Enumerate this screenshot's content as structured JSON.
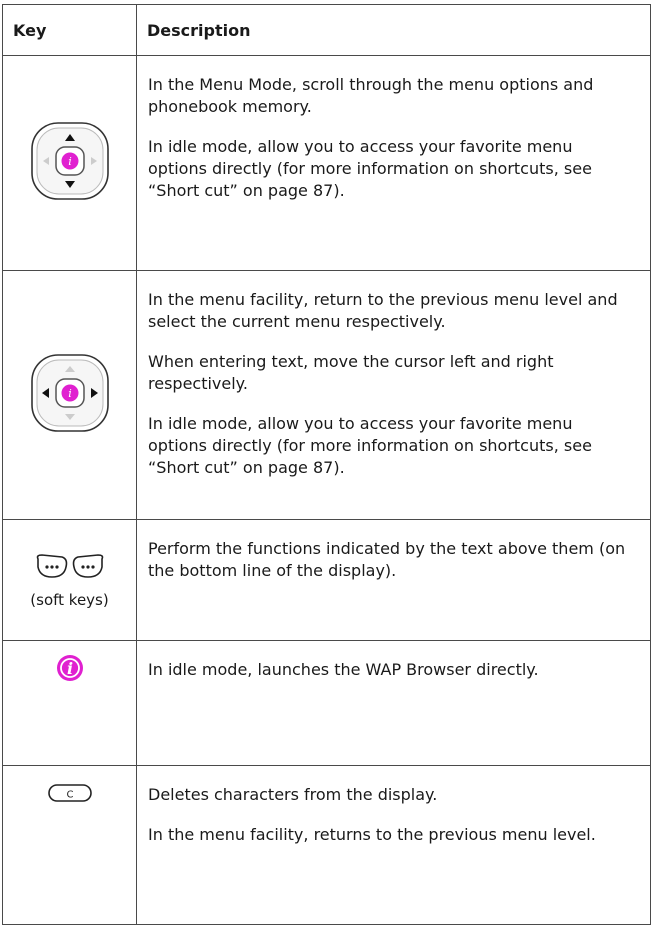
{
  "header": {
    "key": "Key",
    "description": "Description"
  },
  "rows": [
    {
      "icon": "nav-key-up-down-icon",
      "paragraphs": [
        "In the Menu Mode, scroll through the menu options and phonebook memory.",
        "In idle mode, allow you to access your favorite menu options directly (for more information on shortcuts, see “Short cut” on page 87)."
      ]
    },
    {
      "icon": "nav-key-left-right-icon",
      "paragraphs": [
        "In the menu facility, return to the previous menu level and select the current menu respectively.",
        "When entering text, move the cursor left and right respectively.",
        "In idle mode, allow you to access your favorite menu options directly (for more information on shortcuts, see “Short cut” on page 87)."
      ]
    },
    {
      "icon": "soft-keys-icon",
      "label": "(soft keys)",
      "paragraphs": [
        "Perform the functions indicated by the text above them (on the bottom line of the display)."
      ]
    },
    {
      "icon": "wap-browser-key-icon",
      "paragraphs": [
        "In idle mode, launches the WAP Browser directly."
      ]
    },
    {
      "icon": "c-key-icon",
      "key_letter": "C",
      "paragraphs": [
        "Deletes characters from the display.",
        "In the menu facility, returns to the previous menu level."
      ]
    }
  ],
  "colors": {
    "accent": "#e020d0",
    "border": "#4a4a4a"
  }
}
